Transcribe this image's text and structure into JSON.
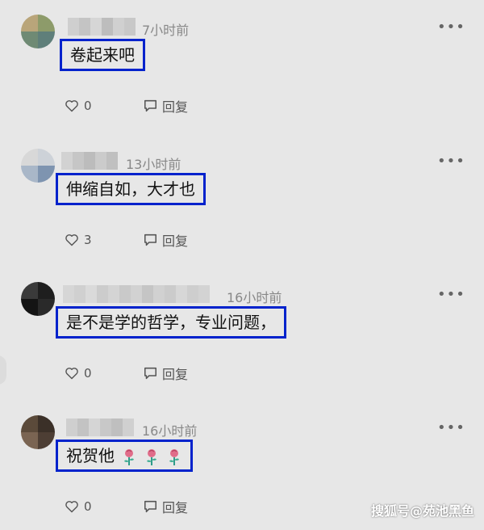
{
  "comments": [
    {
      "time": "7小时前",
      "text": "卷起来吧",
      "likes": "0",
      "reply_label": "回复",
      "emoji_count": 0
    },
    {
      "time": "13小时前",
      "text": "伸缩自如，大才也",
      "likes": "3",
      "reply_label": "回复",
      "emoji_count": 0
    },
    {
      "time": "16小时前",
      "text": "是不是学的哲学，专业问题，",
      "likes": "0",
      "reply_label": "回复",
      "emoji_count": 0
    },
    {
      "time": "16小时前",
      "text": "祝贺他",
      "likes": "0",
      "reply_label": "回复",
      "emoji_count": 3,
      "emoji_icon": "rose-icon"
    }
  ],
  "more_icon": "more-options-icon",
  "like_icon": "heart-icon",
  "reply_icon": "comment-bubble-icon",
  "highlight_color": "#0022cc",
  "background_color": "#e7e7e7",
  "watermark": "搜狐号@苑池黑鱼"
}
